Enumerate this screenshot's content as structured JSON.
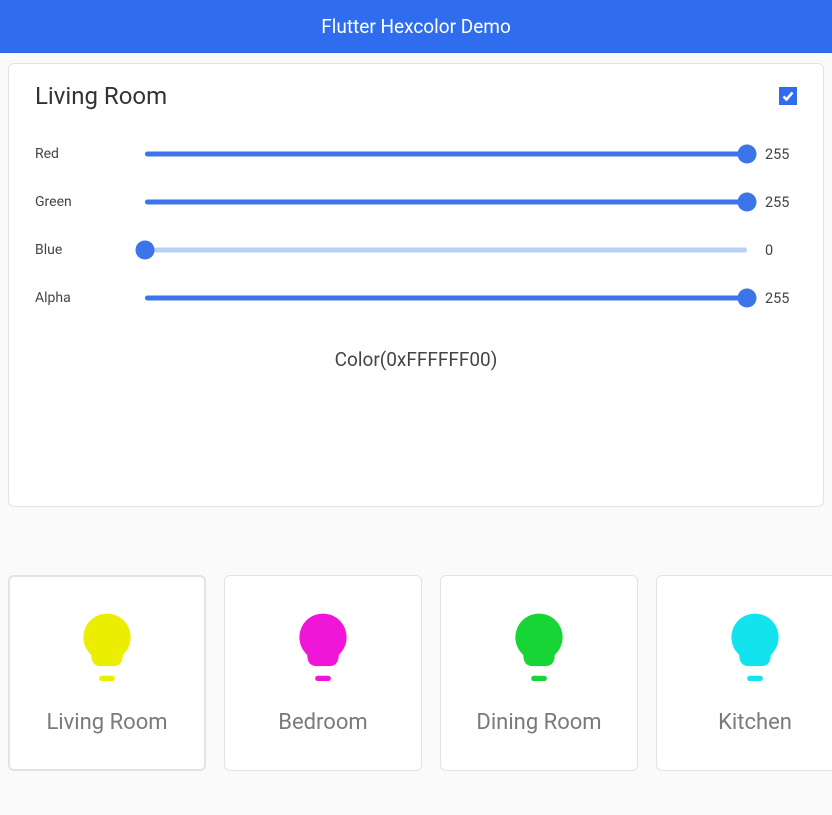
{
  "app": {
    "title": "Flutter Hexcolor Demo"
  },
  "accent": "#2f6cee",
  "panel": {
    "title": "Living Room",
    "checked": true,
    "colorText": "Color(0xFFFFFF00)",
    "sliders": [
      {
        "label": "Red",
        "value": 255,
        "max": 255
      },
      {
        "label": "Green",
        "value": 255,
        "max": 255
      },
      {
        "label": "Blue",
        "value": 0,
        "max": 255
      },
      {
        "label": "Alpha",
        "value": 255,
        "max": 255
      }
    ]
  },
  "rooms": [
    {
      "label": "Living Room",
      "color": "#ecee00",
      "selected": true
    },
    {
      "label": "Bedroom",
      "color": "#ef16d7",
      "selected": false
    },
    {
      "label": "Dining Room",
      "color": "#17d534",
      "selected": false
    },
    {
      "label": "Kitchen",
      "color": "#13e3ef",
      "selected": false
    }
  ]
}
